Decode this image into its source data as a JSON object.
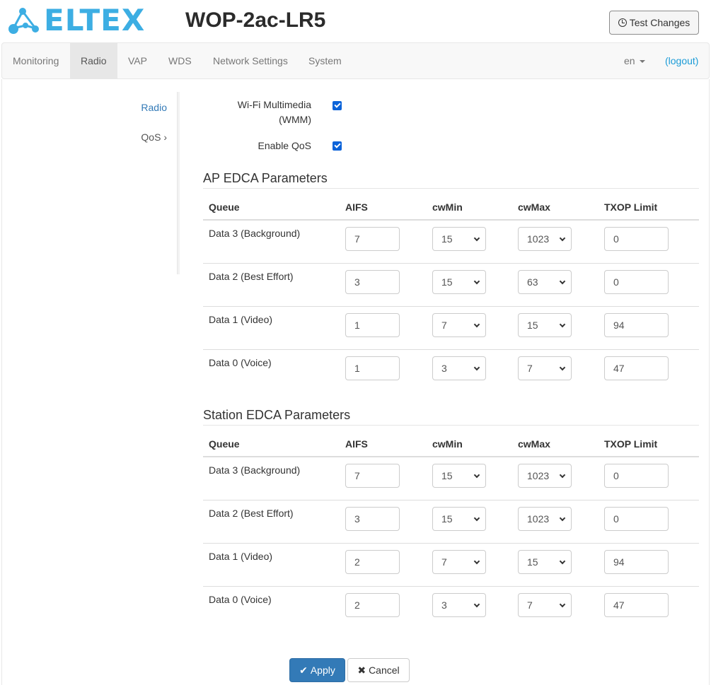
{
  "header": {
    "logo_text": "ELTEX",
    "device_title": "WOP-2ac-LR5",
    "test_changes_label": "Test Changes"
  },
  "nav": {
    "items": [
      "Monitoring",
      "Radio",
      "VAP",
      "WDS",
      "Network Settings",
      "System"
    ],
    "active": "Radio",
    "lang": "en",
    "logout": "(logout)"
  },
  "sidebar": {
    "items": [
      "Radio",
      "QoS ›"
    ],
    "active": "Radio"
  },
  "form": {
    "wmm_label_line1": "Wi-Fi Multimedia",
    "wmm_label_line2": "(WMM)",
    "wmm_checked": true,
    "qos_label": "Enable QoS",
    "qos_checked": true
  },
  "columns": [
    "Queue",
    "AIFS",
    "cwMin",
    "cwMax",
    "TXOP Limit"
  ],
  "ap_edca": {
    "title": "AP EDCA Parameters",
    "rows": [
      {
        "queue": "Data 3 (Background)",
        "aifs": "7",
        "cwmin": "15",
        "cwmax": "1023",
        "txop": "0"
      },
      {
        "queue": "Data 2 (Best Effort)",
        "aifs": "3",
        "cwmin": "15",
        "cwmax": "63",
        "txop": "0"
      },
      {
        "queue": "Data 1 (Video)",
        "aifs": "1",
        "cwmin": "7",
        "cwmax": "15",
        "txop": "94"
      },
      {
        "queue": "Data 0 (Voice)",
        "aifs": "1",
        "cwmin": "3",
        "cwmax": "7",
        "txop": "47"
      }
    ]
  },
  "station_edca": {
    "title": "Station EDCA Parameters",
    "rows": [
      {
        "queue": "Data 3 (Background)",
        "aifs": "7",
        "cwmin": "15",
        "cwmax": "1023",
        "txop": "0"
      },
      {
        "queue": "Data 2 (Best Effort)",
        "aifs": "3",
        "cwmin": "15",
        "cwmax": "1023",
        "txop": "0"
      },
      {
        "queue": "Data 1 (Video)",
        "aifs": "2",
        "cwmin": "7",
        "cwmax": "15",
        "txop": "94"
      },
      {
        "queue": "Data 0 (Voice)",
        "aifs": "2",
        "cwmin": "3",
        "cwmax": "7",
        "txop": "47"
      }
    ]
  },
  "actions": {
    "apply_label": "Apply",
    "cancel_label": "Cancel"
  },
  "colors": {
    "brand": "#3daee3",
    "primary": "#337ab7",
    "link": "#1a9bd7"
  }
}
